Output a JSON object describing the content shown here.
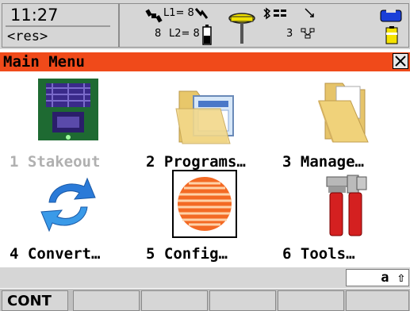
{
  "status": {
    "time": "11:27",
    "result": "<res>",
    "l1_label": "L1= 8",
    "l2_label": "L2= 8",
    "sv_count_left": "8",
    "sv_count_right": "3"
  },
  "title_bar": {
    "title": "Main Menu",
    "close_glyph": "✕"
  },
  "menu": {
    "items": [
      {
        "label": "1 Stakeout",
        "icon": "stakeout-icon",
        "enabled": false
      },
      {
        "label": "2 Programs…",
        "icon": "programs-folder-icon",
        "enabled": true
      },
      {
        "label": "3 Manage…",
        "icon": "manage-folder-icon",
        "enabled": true
      },
      {
        "label": "4 Convert…",
        "icon": "convert-arrows-icon",
        "enabled": true
      },
      {
        "label": "5 Config…",
        "icon": "config-globe-icon",
        "enabled": true,
        "selected": true
      },
      {
        "label": "6 Tools…",
        "icon": "tools-icon",
        "enabled": true
      }
    ]
  },
  "info_bar": {
    "input_mode": "a ⇧"
  },
  "softkeys": {
    "f1": "CONT",
    "f2": "",
    "f3": "",
    "f4": "",
    "f5": "",
    "f6": ""
  },
  "colors": {
    "title_bar": "#f04a1a",
    "chrome_gray": "#d6d6d6",
    "disabled_text": "#b0b0b0"
  }
}
